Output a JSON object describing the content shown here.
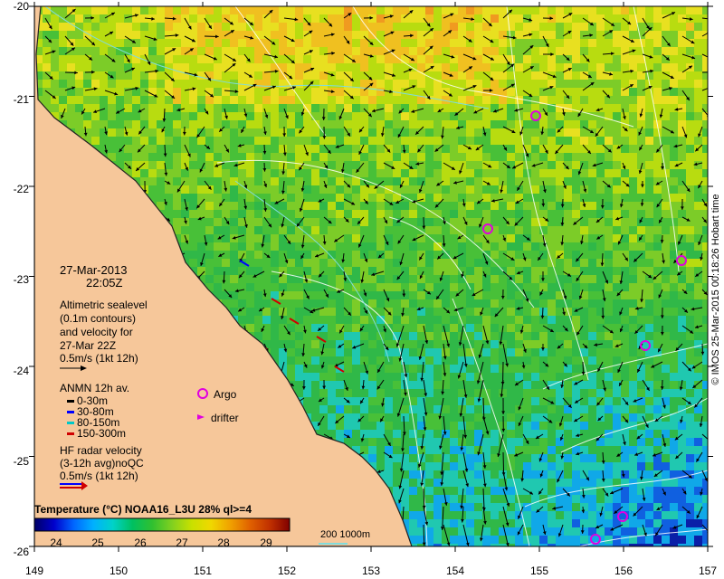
{
  "axes": {
    "y_ticks": [
      "-20",
      "-21",
      "-22",
      "-23",
      "-24",
      "-25",
      "-26"
    ],
    "x_ticks": [
      "149",
      "150",
      "151",
      "152",
      "153",
      "154",
      "155",
      "156",
      "157"
    ]
  },
  "annotation": {
    "date": "27-Mar-2013",
    "time": "22:05Z",
    "altimetry_lines": [
      "Altimetric sealevel",
      "(0.1m contours)",
      "and velocity for",
      "27-Mar 22Z",
      "0.5m/s (1kt 12h)"
    ],
    "anmn_title": "ANMN 12h av.",
    "anmn_depths": [
      "0-30m",
      "30-80m",
      "80-150m",
      "150-300m"
    ],
    "anmn_colors": [
      "#000000",
      "#0000ff",
      "#00c8c8",
      "#d00000"
    ],
    "argo": "Argo",
    "drifter": "drifter",
    "hf_lines": [
      "HF radar velocity",
      "(3-12h avg)noQC",
      "0.5m/s (1kt 12h)"
    ]
  },
  "colorbar": {
    "title": "Temperature (°C) NOAA16_L3U 28% ql>=4",
    "ticks": [
      "24",
      "25",
      "26",
      "27",
      "28",
      "29"
    ],
    "colors": [
      "#000066",
      "#0000cc",
      "#0066ff",
      "#00b0ff",
      "#00d2c8",
      "#00c060",
      "#30c030",
      "#80d020",
      "#c8e000",
      "#f0d800",
      "#f0a000",
      "#e06000",
      "#c03000",
      "#800000"
    ]
  },
  "isobath": {
    "labels": "200  1000m"
  },
  "credit": "© IMOS 25-Mar-2015 00:18:26 Hobart time",
  "colors": {
    "land": "#f6c79a",
    "coast": "#222222",
    "isobath": "#7fdcdc",
    "contour": "#ffffff",
    "argo": "#e000e0"
  }
}
